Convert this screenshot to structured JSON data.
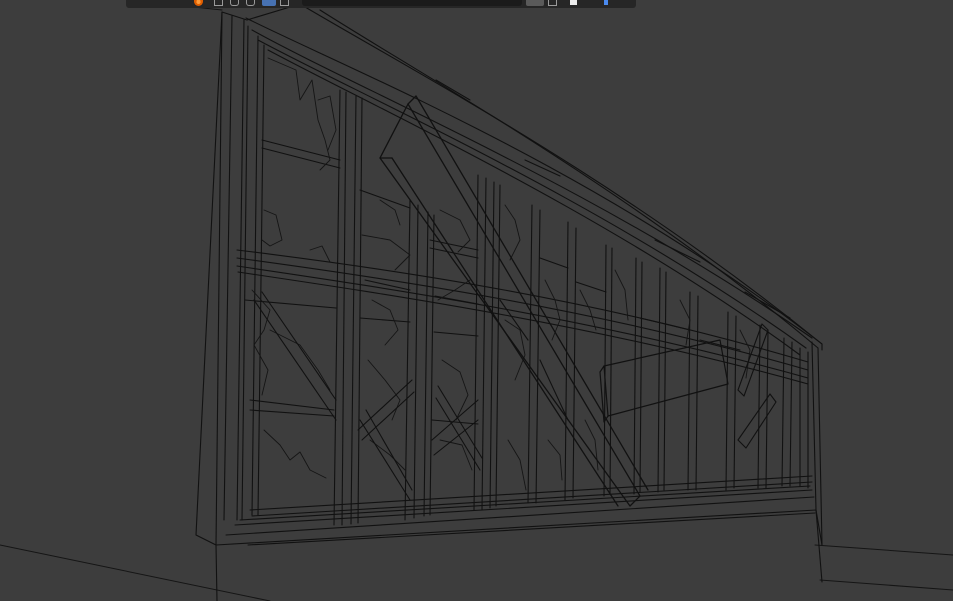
{
  "colors": {
    "background": "#3d3d3d",
    "wire": "#111111",
    "header_bg": "#262626",
    "accent": "#4772b3"
  },
  "viewport": {
    "shading_mode": "wireframe"
  },
  "header": {
    "icons": [
      "blender-logo-icon",
      "selectability-icon",
      "visibility-icon",
      "overlay-icon",
      "xray-icon",
      "camera-icon",
      "pin-icon",
      "view-layer-icon",
      "render-icon"
    ]
  }
}
